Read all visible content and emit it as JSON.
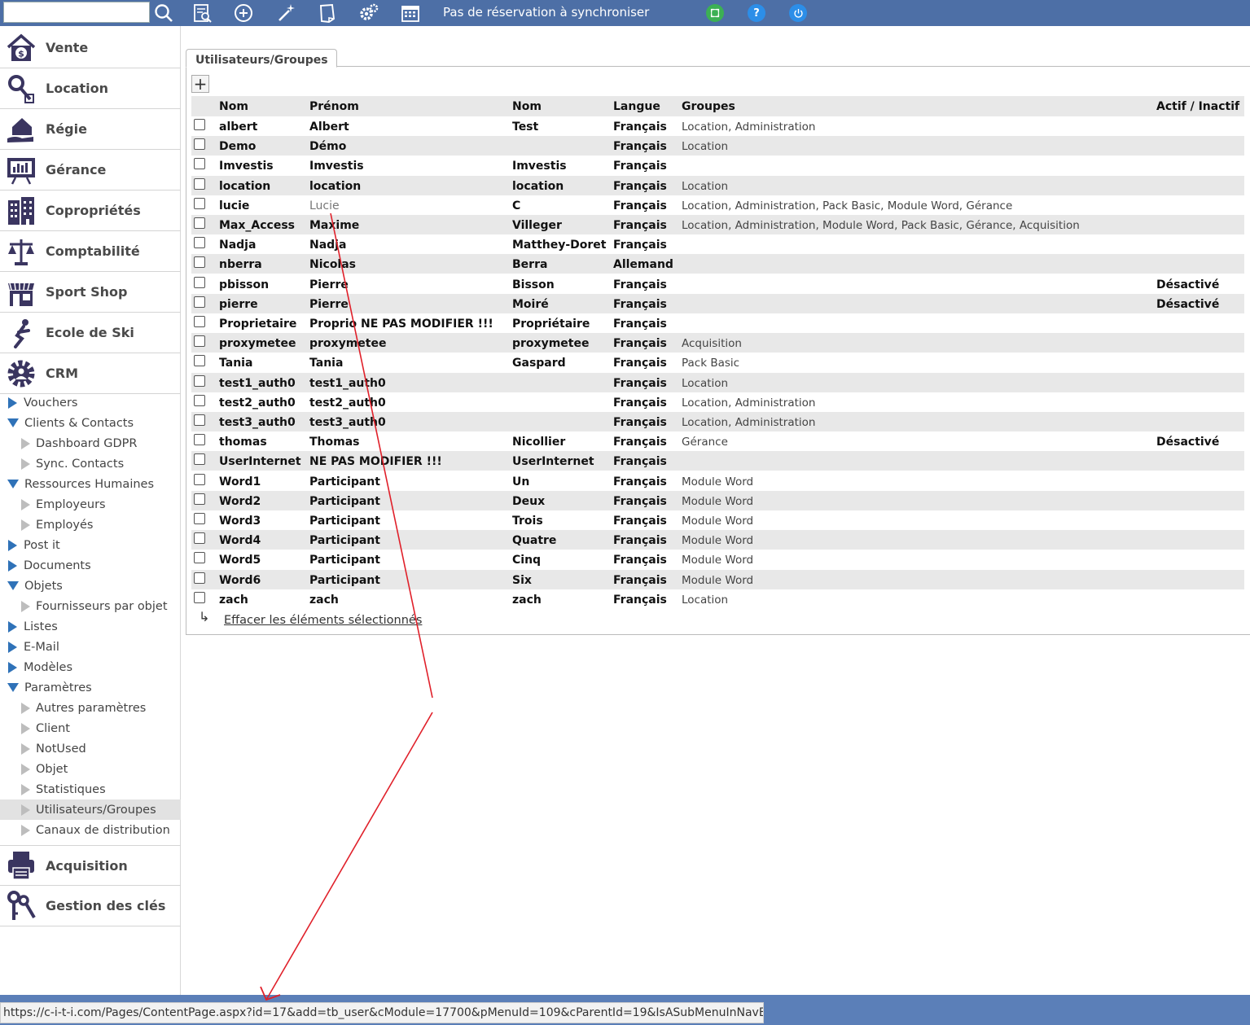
{
  "topbar": {
    "search_placeholder": "",
    "sync_status": "Pas de réservation à synchroniser",
    "icons": [
      "search-icon",
      "report-search-icon",
      "add-circle-icon",
      "magic-wand-icon",
      "note-icon",
      "settings-gears-icon",
      "calendar-icon",
      "fullscreen-icon",
      "help-icon",
      "power-icon"
    ],
    "help_label": "?",
    "colors": {
      "bar": "#4d6fa6",
      "fullscreen": "#3cb054",
      "help": "#2c8ee8",
      "power": "#2c8ee8"
    }
  },
  "sidebar": {
    "modules_top": [
      {
        "label": "Vente",
        "icon": "house-money-icon"
      },
      {
        "label": "Location",
        "icon": "key-icon"
      },
      {
        "label": "Régie",
        "icon": "house-hand-icon"
      },
      {
        "label": "Gérance",
        "icon": "chart-board-icon"
      },
      {
        "label": "Copropriétés",
        "icon": "building-icon"
      },
      {
        "label": "Comptabilité",
        "icon": "scale-icon"
      },
      {
        "label": "Sport Shop",
        "icon": "shop-icon"
      },
      {
        "label": "Ecole de Ski",
        "icon": "skier-icon"
      },
      {
        "label": "CRM",
        "icon": "gear-user-icon"
      }
    ],
    "tree": [
      {
        "label": "Vouchers"
      },
      {
        "label": "Clients & Contacts"
      },
      {
        "label": "Dashboard GDPR"
      },
      {
        "label": "Sync. Contacts"
      },
      {
        "label": "Ressources Humaines"
      },
      {
        "label": "Employeurs"
      },
      {
        "label": "Employés"
      },
      {
        "label": "Post it"
      },
      {
        "label": "Documents"
      },
      {
        "label": "Objets"
      },
      {
        "label": "Fournisseurs par objet"
      },
      {
        "label": "Listes"
      },
      {
        "label": "E-Mail"
      },
      {
        "label": "Modèles"
      },
      {
        "label": "Paramètres"
      },
      {
        "label": "Autres paramètres"
      },
      {
        "label": "Client"
      },
      {
        "label": "NotUsed"
      },
      {
        "label": "Objet"
      },
      {
        "label": "Statistiques"
      },
      {
        "label": "Utilisateurs/Groupes"
      },
      {
        "label": "Canaux de distribution"
      }
    ],
    "modules_bottom": [
      {
        "label": "Acquisition",
        "icon": "printer-icon"
      },
      {
        "label": "Gestion des clés",
        "icon": "keys-icon"
      }
    ]
  },
  "main": {
    "tab_label": "Utilisateurs/Groupes",
    "add_label": "+",
    "headers": [
      "Nom",
      "Prénom",
      "Nom",
      "Langue",
      "Groupes",
      "Actif / Inactif"
    ],
    "rows": [
      [
        "albert",
        "Albert",
        "Test",
        "Français",
        "Location, Administration",
        ""
      ],
      [
        "Demo",
        "Démo",
        "",
        "Français",
        "Location",
        ""
      ],
      [
        "Imvestis",
        "Imvestis",
        "Imvestis",
        "Français",
        "",
        ""
      ],
      [
        "location",
        "location",
        "location",
        "Français",
        "Location",
        ""
      ],
      [
        "lucie",
        "Lucie",
        "C",
        "Français",
        "Location, Administration, Pack Basic, Module Word, Gérance",
        ""
      ],
      [
        "Max_Access",
        "Maxime",
        "Villeger",
        "Français",
        "Location, Administration, Module Word, Pack Basic, Gérance, Acquisition",
        ""
      ],
      [
        "Nadja",
        "Nadja",
        "Matthey-Doret",
        "Français",
        "",
        ""
      ],
      [
        "nberra",
        "Nicolas",
        "Berra",
        "Allemand",
        "",
        ""
      ],
      [
        "pbisson",
        "Pierre",
        "Bisson",
        "Français",
        "",
        "Désactivé"
      ],
      [
        "pierre",
        "Pierre",
        "Moiré",
        "Français",
        "",
        "Désactivé"
      ],
      [
        "Proprietaire",
        "Proprio NE PAS MODIFIER !!!",
        "Propriétaire",
        "Français",
        "",
        ""
      ],
      [
        "proxymetee",
        "proxymetee",
        "proxymetee",
        "Français",
        "Acquisition",
        ""
      ],
      [
        "Tania",
        "Tania",
        "Gaspard",
        "Français",
        "Pack Basic",
        ""
      ],
      [
        "test1_auth0",
        "test1_auth0",
        "",
        "Français",
        "Location",
        ""
      ],
      [
        "test2_auth0",
        "test2_auth0",
        "",
        "Français",
        "Location, Administration",
        ""
      ],
      [
        "test3_auth0",
        "test3_auth0",
        "",
        "Français",
        "Location, Administration",
        ""
      ],
      [
        "thomas",
        "Thomas",
        "Nicollier",
        "Français",
        "Gérance",
        "Désactivé"
      ],
      [
        "UserInternet",
        "NE PAS MODIFIER !!!",
        "UserInternet",
        "Français",
        "",
        ""
      ],
      [
        "Word1",
        "Participant",
        "Un",
        "Français",
        "Module Word",
        ""
      ],
      [
        "Word2",
        "Participant",
        "Deux",
        "Français",
        "Module Word",
        ""
      ],
      [
        "Word3",
        "Participant",
        "Trois",
        "Français",
        "Module Word",
        ""
      ],
      [
        "Word4",
        "Participant",
        "Quatre",
        "Français",
        "Module Word",
        ""
      ],
      [
        "Word5",
        "Participant",
        "Cinq",
        "Français",
        "Module Word",
        ""
      ],
      [
        "Word6",
        "Participant",
        "Six",
        "Français",
        "Module Word",
        ""
      ],
      [
        "zach",
        "zach",
        "zach",
        "Français",
        "Location",
        ""
      ]
    ],
    "delete_link": "Effacer les éléments sélectionnés",
    "return_arrow": "↳"
  },
  "statusbar": {
    "url": "https://c-i-t-i.com/Pages/ContentPage.aspx?id=17&add=tb_user&cModule=17700&pMenuId=109&cParentId=19&IsASubMenuInNavBar=1"
  }
}
